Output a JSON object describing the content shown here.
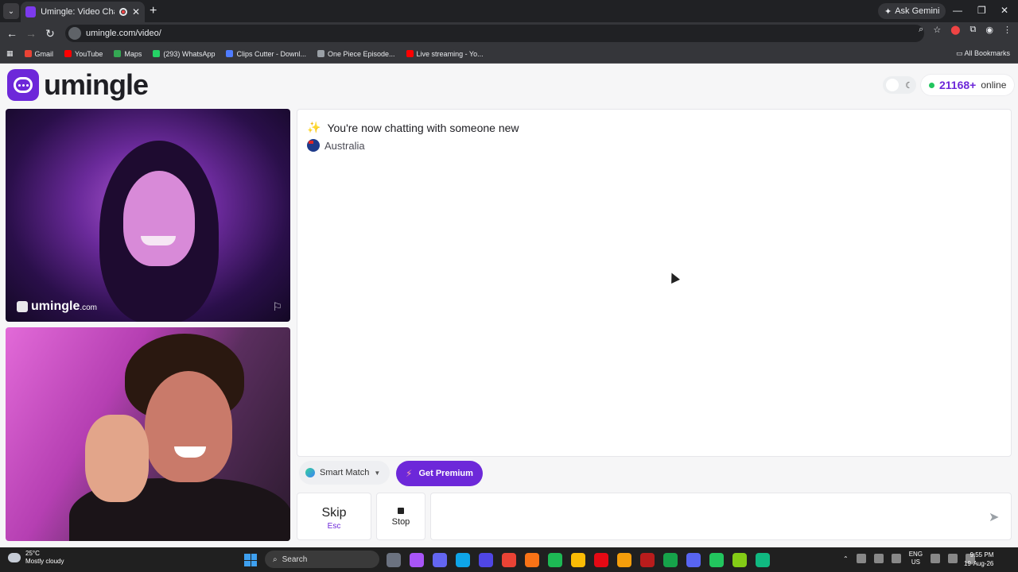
{
  "browser": {
    "tab_title": "Umingle: Video Chat with St",
    "url": "umingle.com/video/",
    "ask_gemini": "Ask Gemini",
    "bookmarks": [
      {
        "label": "Gmail",
        "color": "#ea4335"
      },
      {
        "label": "YouTube",
        "color": "#ff0000"
      },
      {
        "label": "Maps",
        "color": "#34a853"
      },
      {
        "label": "(293) WhatsApp",
        "color": "#25d366"
      },
      {
        "label": "Clips Cutter - Downl...",
        "color": "#4f7cff"
      },
      {
        "label": "One Piece Episode...",
        "color": "#9aa0a6"
      },
      {
        "label": "Live streaming - Yo...",
        "color": "#ff0000"
      }
    ],
    "all_bookmarks": "All Bookmarks"
  },
  "header": {
    "logo_text": "umingle",
    "online_count": "21168+",
    "online_label": "online"
  },
  "video": {
    "watermark": "umingle",
    "watermark_domain": ".com"
  },
  "chat": {
    "status_message": "You're now chatting with someone new",
    "country": "Australia",
    "input_value": "",
    "input_placeholder": ""
  },
  "controls": {
    "smart_match": "Smart Match",
    "get_premium": "Get Premium",
    "skip": "Skip",
    "skip_key": "Esc",
    "stop": "Stop"
  },
  "taskbar": {
    "temperature": "25°C",
    "weather": "Mostly cloudy",
    "search": "Search",
    "lang_top": "ENG",
    "lang_bottom": "US",
    "time": "9:55 PM",
    "date": "19-Aug-26"
  },
  "colors": {
    "brand": "#6d28d9",
    "online": "#22c55e"
  }
}
